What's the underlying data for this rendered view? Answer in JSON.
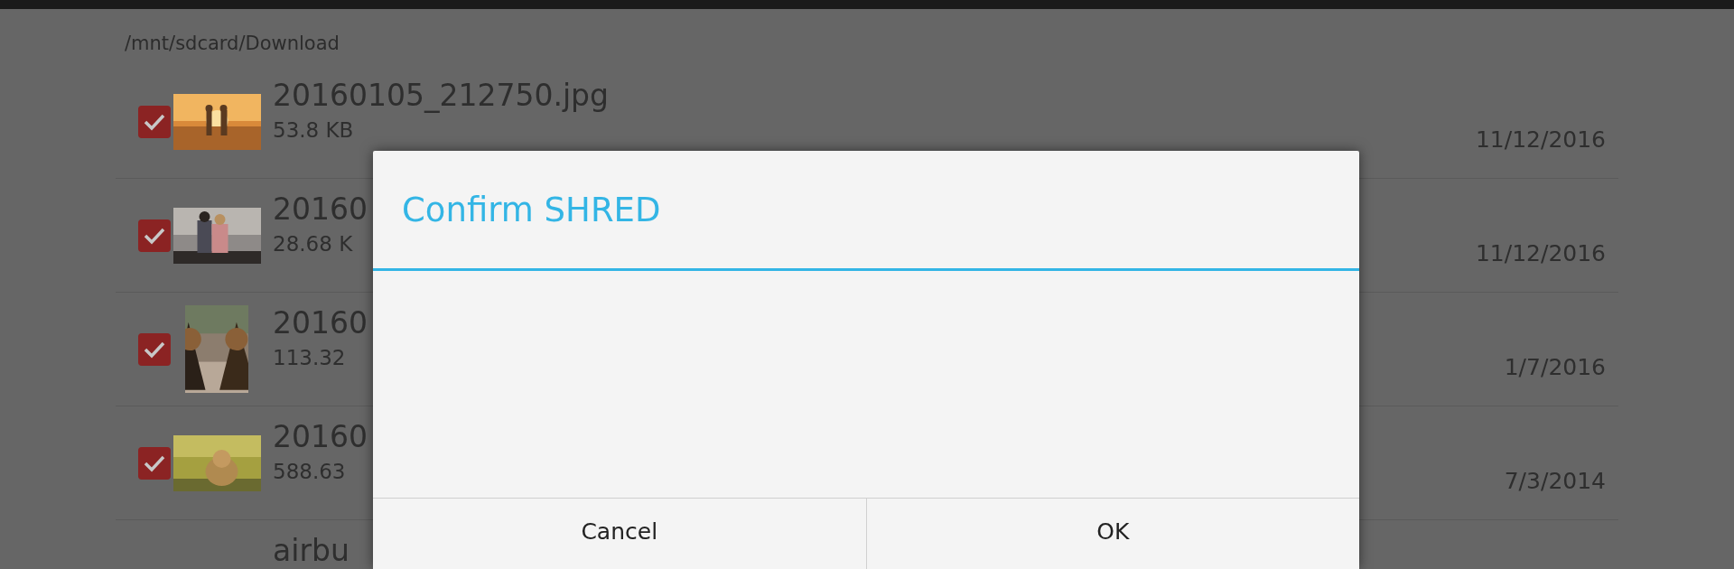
{
  "path": "/mnt/sdcard/Download",
  "files": [
    {
      "name": "20160105_212750.jpg",
      "size": "53.8 KB",
      "date": "11/12/2016",
      "checked": true
    },
    {
      "name": "20160",
      "size": "28.68 K",
      "date": "11/12/2016",
      "checked": true
    },
    {
      "name": "20160",
      "size": "113.32",
      "date": "1/7/2016",
      "checked": true
    },
    {
      "name": "20160",
      "size": "588.63",
      "date": "7/3/2014",
      "checked": true
    },
    {
      "name": "airbu"
    }
  ],
  "dialog": {
    "title": "Confirm SHRED",
    "buttons": [
      "Cancel",
      "OK"
    ]
  }
}
